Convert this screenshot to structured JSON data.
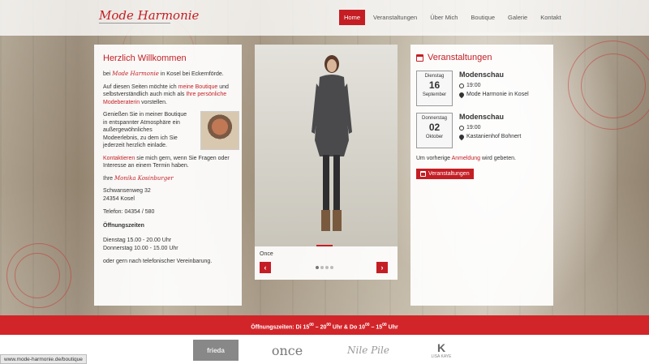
{
  "site": {
    "logo": "Mode Harmonie",
    "brand_color": "#c41e24"
  },
  "nav": {
    "items": [
      {
        "label": "Home",
        "active": true
      },
      {
        "label": "Veranstaltungen",
        "active": false
      },
      {
        "label": "Über Mich",
        "active": false
      },
      {
        "label": "Boutique",
        "active": false
      },
      {
        "label": "Galerie",
        "active": false
      },
      {
        "label": "Kontakt",
        "active": false
      }
    ]
  },
  "welcome": {
    "title": "Herzlich Willkommen",
    "intro_pre": "bei",
    "intro_brand": "Mode Harmonie",
    "intro_post": "in Kosel bei Eckernförde.",
    "p2_a": "Auf diesen Seiten möchte ich",
    "p2_link1": "meine Boutique",
    "p2_b": "und selbstverständlich auch mich als",
    "p2_link2": "Ihre persönliche Modeberaterin",
    "p2_c": "vorstellen.",
    "p3": "Genießen Sie in meiner Boutique in entspannter Atmosphäre ein außergewöhnliches Modeerlebnis, zu dem ich Sie jederzeit herzlich einlade.",
    "p4_link": "Kontaktieren",
    "p4": "sie mich gern, wenn Sie Fragen oder Interesse an einem Termin haben.",
    "signature_pre": "Ihre",
    "signature": "Monika Kosinburger",
    "street": "Schwansenweg 32",
    "city": "24354 Kosel",
    "phone": "Telefon: 04354 / 580",
    "hours_title": "Öffnungszeiten",
    "hours_1": "Dienstag 15.00 - 20.00 Uhr",
    "hours_2": "Donnerstag 10.00 - 15.00 Uhr",
    "hours_note": "oder gern nach telefonischer Vereinbarung."
  },
  "slider": {
    "caption": "Once",
    "prev_icon": "chevron-left-icon",
    "next_icon": "chevron-right-icon",
    "prev": "‹",
    "next": "›",
    "progress": 0.25
  },
  "events": {
    "title": "Veranstaltungen",
    "items": [
      {
        "dow": "Dienstag",
        "day": "16",
        "month": "September",
        "title": "Modenschau",
        "time": "19:00",
        "place": "Mode Harmonie in Kosel"
      },
      {
        "dow": "Donnerstag",
        "day": "02",
        "month": "Oktober",
        "title": "Modenschau",
        "time": "19:00",
        "place": "Kastanienhof Bohnert"
      }
    ],
    "reg_pre": "Um vorherige",
    "reg_link": "Anmeldung",
    "reg_post": "wird gebeten.",
    "button": "Veranstaltungen"
  },
  "banner": {
    "label": "Öffnungszeiten:",
    "d1": "Di 15",
    "s1": "00",
    "m1": " – 20",
    "s2": "00",
    "m2": " Uhr & Do 10",
    "s3": "00",
    "m3": " – 15",
    "s4": "00",
    "m4": " Uhr"
  },
  "brands": [
    "frieda",
    "once",
    "Nile Pile",
    "LISA KAYE"
  ],
  "status_url": "www.mode-harmonie.de/boutique"
}
